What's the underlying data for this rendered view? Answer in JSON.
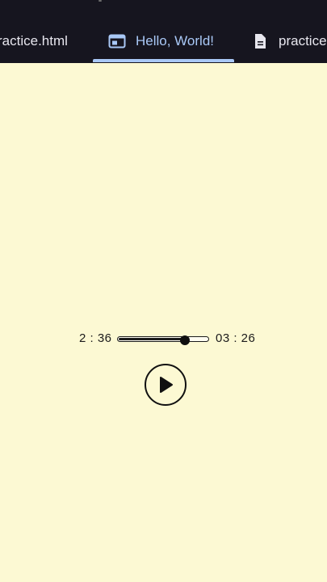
{
  "tabs": [
    {
      "label": "ractice.html",
      "icon": "none",
      "active": false
    },
    {
      "label": "Hello, World!",
      "icon": "browser-window-icon",
      "active": true
    },
    {
      "label": "practice",
      "icon": "document-icon",
      "active": false
    }
  ],
  "player": {
    "current_time": "2 : 36",
    "total_time": "03 : 26",
    "progress_fraction": 0.73,
    "play_button_icon": "play-icon"
  },
  "colors": {
    "background": "#fcf9d3",
    "tab_bar": "#16151f",
    "active_tab": "#a9c8f6"
  }
}
